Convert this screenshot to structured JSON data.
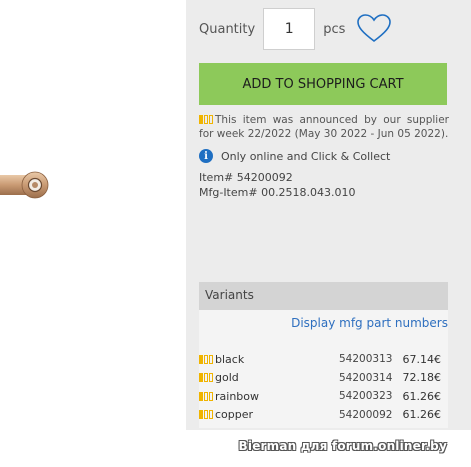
{
  "quantity": {
    "label": "Quantity",
    "value": "1",
    "unit": "pcs"
  },
  "wishlist_icon": "heart-outline-icon",
  "cart": {
    "button_label": "ADD TO SHOPPING CART",
    "button_color": "#8dc95a"
  },
  "announcement": {
    "text": "This item was announced by our supplier for week 22/2022 (May 30 2022 - Jun 05 2022).",
    "stock_level": 1
  },
  "info": {
    "text": "Only online and Click & Collect",
    "icon": "info-icon"
  },
  "item": {
    "number_label": "Item# 54200092",
    "mfg_label": "Mfg-Item# 00.2518.043.010"
  },
  "variants": {
    "header": "Variants",
    "mfg_link": "Display mfg part numbers",
    "rows": [
      {
        "name": "black",
        "item": "54200313",
        "price": "67.14€",
        "stock_level": 1
      },
      {
        "name": "gold",
        "item": "54200314",
        "price": "72.18€",
        "stock_level": 1
      },
      {
        "name": "rainbow",
        "item": "54200323",
        "price": "61.26€",
        "stock_level": 1
      },
      {
        "name": "copper",
        "item": "54200092",
        "price": "61.26€",
        "stock_level": 1
      }
    ]
  },
  "watermark": "Bierman для forum.onliner.by",
  "colors": {
    "accent_green": "#8dc95a",
    "link_blue": "#2e6fbf",
    "stock_yellow": "#f0b400",
    "info_blue": "#1f6fc2"
  }
}
